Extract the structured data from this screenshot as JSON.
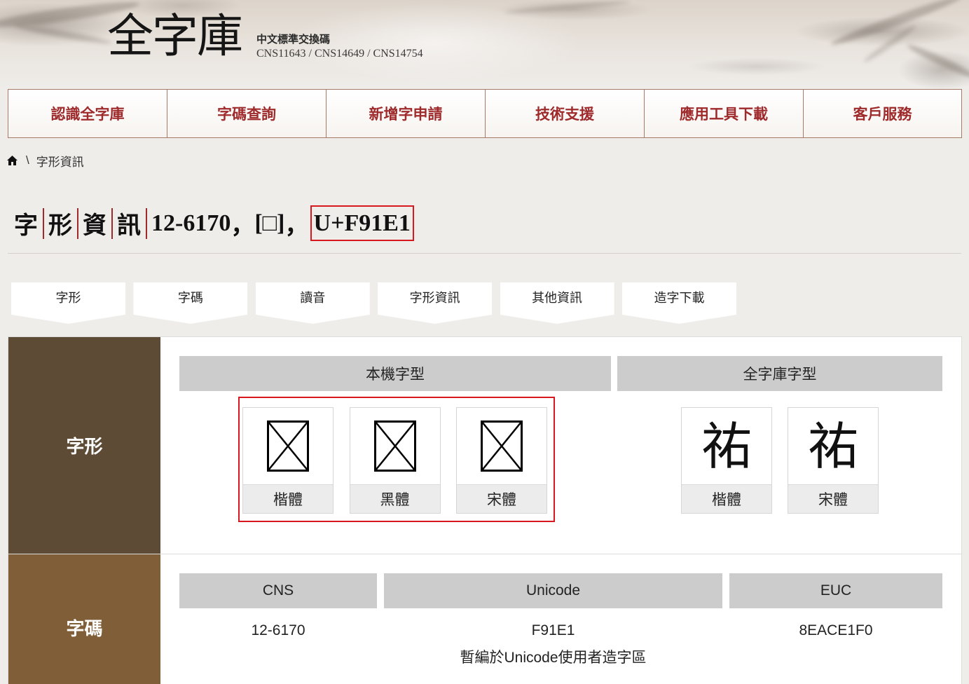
{
  "header": {
    "logo_text": "全字庫",
    "subtitle": "中文標準交換碼",
    "standards": "CNS11643 / CNS14649 / CNS14754"
  },
  "nav": {
    "items": [
      {
        "label": "認識全字庫"
      },
      {
        "label": "字碼查詢"
      },
      {
        "label": "新增字申請"
      },
      {
        "label": "技術支援"
      },
      {
        "label": "應用工具下載"
      },
      {
        "label": "客戶服務"
      }
    ]
  },
  "breadcrumb": {
    "home_icon": "home-icon",
    "separator": "\\",
    "current": "字形資訊"
  },
  "title": {
    "label_chars": [
      "字",
      "形",
      "資",
      "訊"
    ],
    "cns_code": "12-6170",
    "comma": "，",
    "glyph": "[□]",
    "unicode": "U+F91E1"
  },
  "tabs": [
    {
      "label": "字形"
    },
    {
      "label": "字碼"
    },
    {
      "label": "讀音"
    },
    {
      "label": "字形資訊"
    },
    {
      "label": "其他資訊"
    },
    {
      "label": "造字下載"
    }
  ],
  "glyph_section": {
    "label": "字形",
    "local_fonts": {
      "heading": "本機字型",
      "cards": [
        {
          "label": "楷體",
          "glyph_icon": "missing-glyph-icon"
        },
        {
          "label": "黑體",
          "glyph_icon": "missing-glyph-icon"
        },
        {
          "label": "宋體",
          "glyph_icon": "missing-glyph-icon"
        }
      ]
    },
    "cns_fonts": {
      "heading": "全字庫字型",
      "cards": [
        {
          "label": "楷體",
          "glyph": "祐"
        },
        {
          "label": "宋體",
          "glyph": "祐"
        }
      ]
    }
  },
  "code_section": {
    "label": "字碼",
    "columns": [
      {
        "header": "CNS",
        "value": "12-6170"
      },
      {
        "header": "Unicode",
        "value": "F91E1",
        "note": "暫編於Unicode使用者造字區"
      },
      {
        "header": "EUC",
        "value": "8EACE1F0"
      }
    ]
  },
  "colors": {
    "accent_red": "#9e2a2b",
    "highlight_red": "#d7191f",
    "glyph_row_bg": "#5e4b35",
    "code_row_bg": "#805f38",
    "header_bar_bg": "#cccccc"
  }
}
